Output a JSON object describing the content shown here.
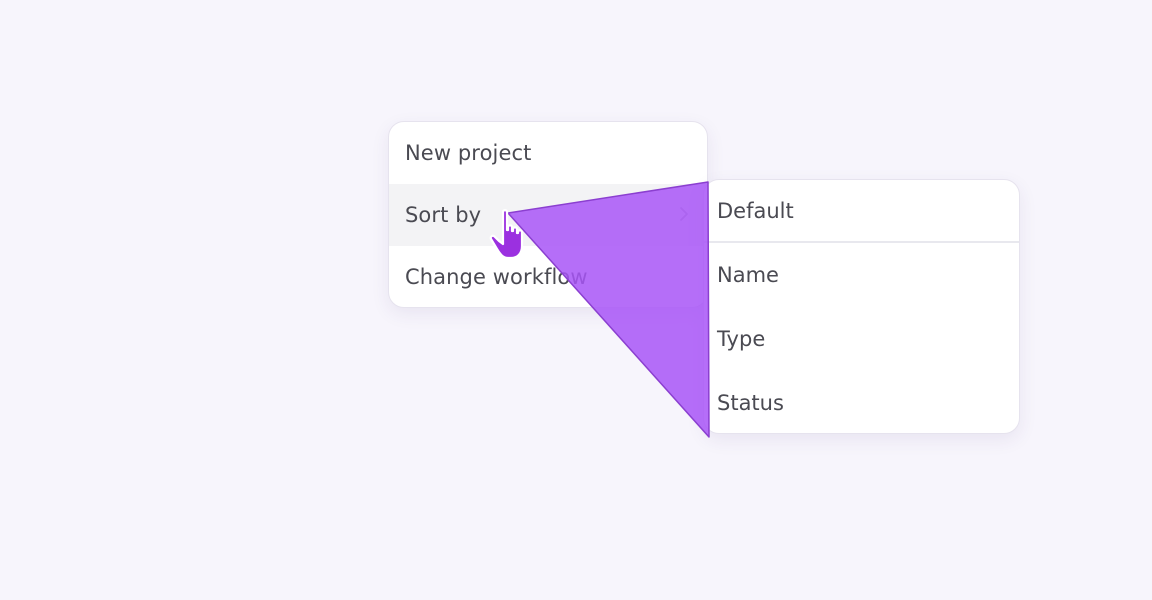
{
  "menu": {
    "items": [
      {
        "label": "New project",
        "has_submenu": false,
        "active": false
      },
      {
        "label": "Sort by",
        "has_submenu": true,
        "active": true
      },
      {
        "label": "Change workflow",
        "has_submenu": false,
        "active": false
      }
    ]
  },
  "submenu": {
    "items": [
      {
        "label": "Default"
      },
      {
        "label": "Name"
      },
      {
        "label": "Type"
      },
      {
        "label": "Status"
      }
    ]
  },
  "icons": {
    "chevron": "chevron-right-icon",
    "cursor": "hand-pointer-cursor-icon"
  },
  "colors": {
    "background": "#f7f5fc",
    "accent": "#a855f7",
    "cursor": "#9b30e0",
    "text": "#4a4a52",
    "active_row": "#f3f3f5"
  }
}
